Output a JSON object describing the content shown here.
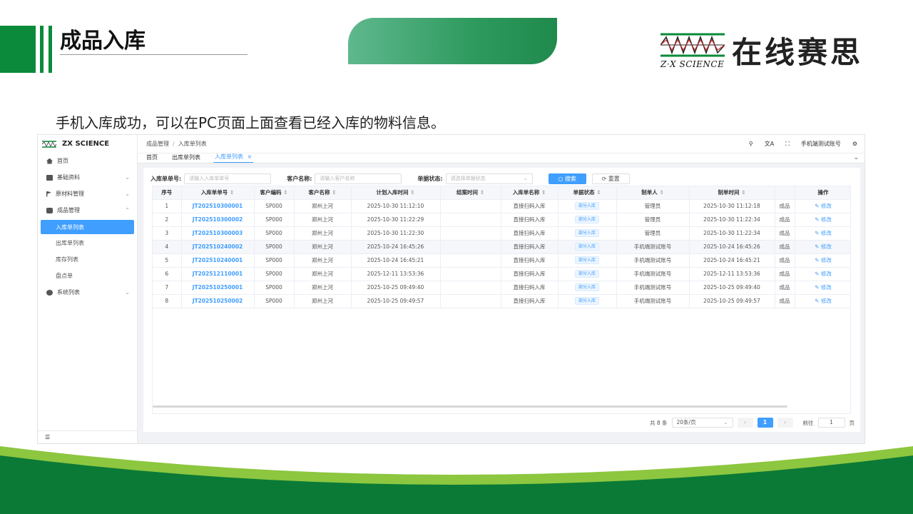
{
  "slide": {
    "title": "成品入库",
    "caption": "手机入库成功，可以在PC页面上面查看已经入库的物料信息。",
    "logo_cn": "在线赛思",
    "logo_en": "Z·X SCIENCE"
  },
  "app": {
    "brand": "ZX SCIENCE",
    "sidebar": {
      "items": [
        {
          "label": "首页",
          "icon": "home-icon"
        },
        {
          "label": "基础资料",
          "icon": "database-icon"
        },
        {
          "label": "原材料管理",
          "icon": "flag-icon"
        },
        {
          "label": "成品管理",
          "icon": "box-icon"
        }
      ],
      "sub_items": [
        "入库单列表",
        "出库单列表",
        "库存列表",
        "盘点单"
      ],
      "system": "系统列表",
      "collapse": "☰"
    },
    "breadcrumb": [
      "成品管理",
      "入库单列表"
    ],
    "user": "手机端测试账号",
    "tabs": [
      "首页",
      "出库单列表",
      "入库单列表"
    ],
    "filters": {
      "order_label": "入库单单号:",
      "order_placeholder": "请输入入库单单号",
      "customer_label": "客户名称:",
      "customer_placeholder": "请输入客户名称",
      "status_label": "单据状态:",
      "status_placeholder": "请选择单据状态",
      "search_label": "搜索",
      "reset_label": "重置"
    },
    "table": {
      "columns": [
        "序号",
        "入库单单号",
        "客户编码",
        "客户名称",
        "计划入库时间",
        "结案时间",
        "入库单名称",
        "单据状态",
        "制单人",
        "制单时间",
        "",
        "操作"
      ],
      "rows": [
        [
          "1",
          "JT202510300001",
          "SP000",
          "郑州上河",
          "2025-10-30 11:12:10",
          "",
          "直接扫码入库",
          "部分入库",
          "管理员",
          "2025-10-30 11:12:18",
          "成品",
          "修改"
        ],
        [
          "2",
          "JT202510300002",
          "SP000",
          "郑州上河",
          "2025-10-30 11:22:29",
          "",
          "直接扫码入库",
          "部分入库",
          "管理员",
          "2025-10-30 11:22:34",
          "成品",
          "修改"
        ],
        [
          "3",
          "JT202510300003",
          "SP000",
          "郑州上河",
          "2025-10-30 11:22:30",
          "",
          "直接扫码入库",
          "部分入库",
          "管理员",
          "2025-10-30 11:22:34",
          "成品",
          "修改"
        ],
        [
          "4",
          "JT202510240002",
          "SP000",
          "郑州上河",
          "2025-10-24 16:45:26",
          "",
          "直接扫码入库",
          "部分入库",
          "手机端测试账号",
          "2025-10-24 16:45:26",
          "成品",
          "修改"
        ],
        [
          "5",
          "JT202510240001",
          "SP000",
          "郑州上河",
          "2025-10-24 16:45:21",
          "",
          "直接扫码入库",
          "部分入库",
          "手机端测试账号",
          "2025-10-24 16:45:21",
          "成品",
          "修改"
        ],
        [
          "6",
          "JT202512110001",
          "SP000",
          "郑州上河",
          "2025-12-11 13:53:36",
          "",
          "直接扫码入库",
          "部分入库",
          "手机端测试账号",
          "2025-12-11 13:53:36",
          "成品",
          "修改"
        ],
        [
          "7",
          "JT202510250001",
          "SP000",
          "郑州上河",
          "2025-10-25 09:49:40",
          "",
          "直接扫码入库",
          "部分入库",
          "手机端测试账号",
          "2025-10-25 09:49:40",
          "成品",
          "修改"
        ],
        [
          "8",
          "JT202510250002",
          "SP000",
          "郑州上河",
          "2025-10-25 09:49:57",
          "",
          "直接扫码入库",
          "部分入库",
          "手机端测试账号",
          "2025-10-25 09:49:57",
          "成品",
          "修改"
        ]
      ]
    },
    "pagination": {
      "total": "共 8 条",
      "page_size": "20条/页",
      "current": "1",
      "goto_label": "前往",
      "goto_value": "1",
      "page_unit": "页"
    }
  },
  "colors": {
    "brand_green": "#0a8a3a",
    "primary_blue": "#409eff"
  }
}
